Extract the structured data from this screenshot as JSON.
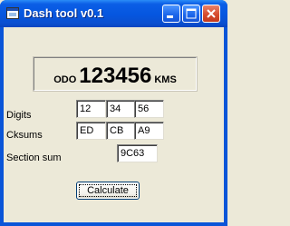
{
  "window": {
    "title": "Dash tool v0.1",
    "app_icon": "app-icon",
    "controls": [
      "minimize-icon",
      "maximize-icon",
      "close-icon"
    ],
    "accent": "#0a55d8"
  },
  "odometer": {
    "prefix": "ODO",
    "value": "123456",
    "unit": "KMS"
  },
  "digits": {
    "label": "Digits",
    "values": [
      "12",
      "34",
      "56"
    ]
  },
  "cksums": {
    "label": "Cksums",
    "values": [
      "ED",
      "CB",
      "A9"
    ]
  },
  "section_sum": {
    "label": "Section sum",
    "value": "9C63"
  },
  "button": {
    "label": "Calculate"
  }
}
